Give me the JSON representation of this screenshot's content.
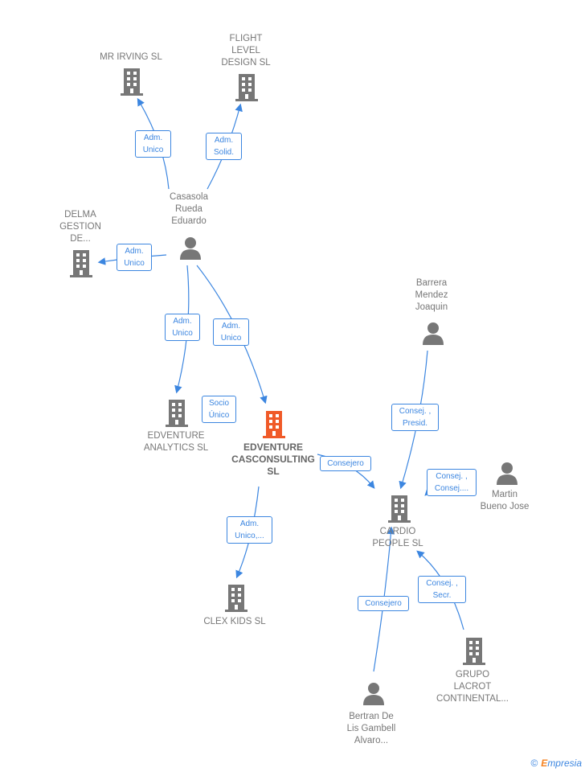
{
  "colors": {
    "edge": "#3c86e0",
    "node": "#777777",
    "highlight": "#f05a28"
  },
  "nodes": {
    "mr_irving": "MR IRVING  SL",
    "flight": "FLIGHT\nLEVEL\nDESIGN  SL",
    "casasola": "Casasola\nRueda\nEduardo",
    "delma": "DELMA\nGESTION\nDE...",
    "edv_analytics": "EDVENTURE\nANALYTICS  SL",
    "edv_cas": "EDVENTURE\nCASCONSULTING\nSL",
    "clex": "CLEX KIDS  SL",
    "barrera": "Barrera\nMendez\nJoaquin",
    "cardio": "CARDIO\nPEOPLE  SL",
    "martin": "Martin\nBueno Jose",
    "grupo": "GRUPO\nLACROT\nCONTINENTAL...",
    "bertran": "Bertran De\nLis Gambell\nAlvaro..."
  },
  "relations": {
    "r1": "Adm.\nUnico",
    "r2": "Adm.\nSolid.",
    "r3": "Adm.\nUnico",
    "r4": "Adm.\nUnico",
    "r5": "Adm.\nUnico",
    "r6": "Socio\nÚnico",
    "r7": "Consejero",
    "r8": "Adm.\nUnico,...",
    "r9": "Consej. ,\nPresid.",
    "r10": "Consej. ,\nConsej....",
    "r11": "Consej. ,\nSecr.",
    "r12": "Consejero"
  },
  "footer": {
    "copyright": "©",
    "brand_e": "E",
    "brand_rest": "mpresia"
  }
}
